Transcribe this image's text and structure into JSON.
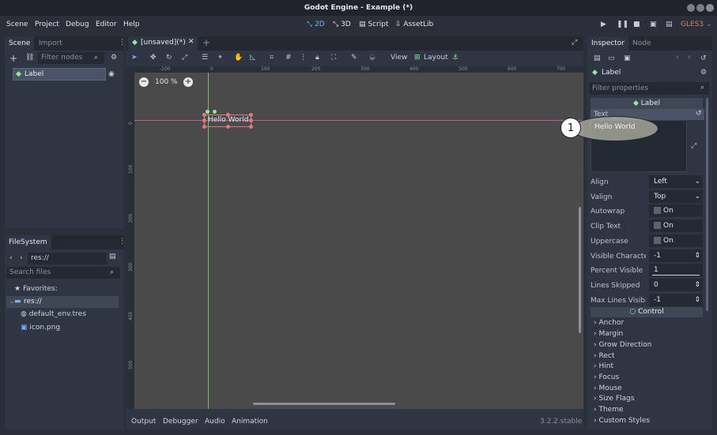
{
  "window": {
    "title": "Godot Engine - Example (*)"
  },
  "menu": {
    "items": [
      "Scene",
      "Project",
      "Debug",
      "Editor",
      "Help"
    ]
  },
  "modes": {
    "m2d": "2D",
    "m3d": "3D",
    "script": "Script",
    "assetlib": "AssetLib"
  },
  "renderer": "GLES3",
  "scene_dock": {
    "tab_scene": "Scene",
    "tab_import": "Import",
    "filter_placeholder": "Filter nodes",
    "node_label": "Label"
  },
  "filesystem": {
    "tab": "FileSystem",
    "path": "res://",
    "search_placeholder": "Search files",
    "favorites": "Favorites:",
    "root": "res://",
    "files": [
      "default_env.tres",
      "icon.png"
    ]
  },
  "viewport": {
    "tab_label": "[unsaved](*)",
    "view_label": "View",
    "layout_label": "Layout",
    "zoom": "100 %",
    "node_text": "Hello World",
    "ruler_h": [
      "-100",
      "0",
      "100",
      "200",
      "300",
      "400",
      "500",
      "600",
      "700"
    ],
    "ruler_v": [
      "0",
      "100",
      "200",
      "300",
      "400",
      "500"
    ]
  },
  "bottom_panel": {
    "tabs": [
      "Output",
      "Debugger",
      "Audio",
      "Animation"
    ],
    "version": "3.2.2.stable"
  },
  "inspector": {
    "tab_inspector": "Inspector",
    "tab_node": "Node",
    "object_label": "Label",
    "filter_placeholder": "Filter properties",
    "class_header": "Label",
    "text_label": "Text",
    "text_value": "Hello World",
    "annotation_number": "1",
    "properties": [
      {
        "name": "Align",
        "value": "Left"
      },
      {
        "name": "Valign",
        "value": "Top"
      },
      {
        "name": "Autowrap",
        "value": "On"
      },
      {
        "name": "Clip Text",
        "value": "On"
      },
      {
        "name": "Uppercase",
        "value": "On"
      },
      {
        "name": "Visible Characte",
        "value": "-1"
      },
      {
        "name": "Percent Visible",
        "value": "1"
      },
      {
        "name": "Lines Skipped",
        "value": "0"
      },
      {
        "name": "Max Lines Visibl",
        "value": "-1"
      }
    ],
    "control_header": "Control",
    "sections": [
      "Anchor",
      "Margin",
      "Grow Direction",
      "Rect",
      "Hint",
      "Focus",
      "Mouse",
      "Size Flags",
      "Theme",
      "Custom Styles"
    ]
  },
  "colors": {
    "accent": "#6fb1ff",
    "renderer": "#e0796b",
    "label_icon": "#8eef97",
    "guide": "#c9589a",
    "axis_v": "#6fbf6f"
  }
}
